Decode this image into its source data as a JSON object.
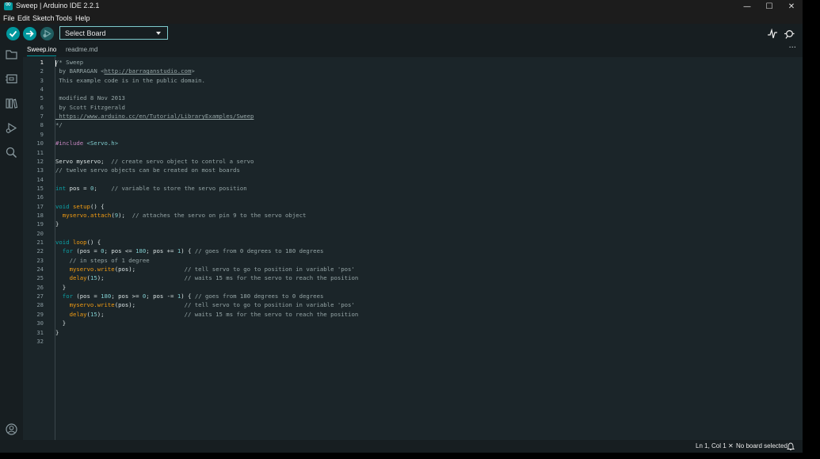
{
  "window": {
    "title": "Sweep | Arduino IDE 2.2.1",
    "controls": [
      "—",
      "☐",
      "✕"
    ]
  },
  "menu": {
    "items": [
      "File",
      "Edit",
      "Sketch",
      "Tools",
      "Help"
    ]
  },
  "toolbar": {
    "verify_icon": "check-icon",
    "upload_icon": "arrow-right-icon",
    "debug_icon": "debug-icon",
    "board_select": "Select Board",
    "serial_plotter_icon": "plotter-icon",
    "serial_monitor_icon": "monitor-icon"
  },
  "sidebar": {
    "icons": [
      "folder-icon",
      "board-icon",
      "library-icon",
      "debug-icon",
      "search-icon"
    ],
    "profile_icon": "user-icon"
  },
  "tabs": [
    {
      "label": "Sweep.ino",
      "active": true
    },
    {
      "label": "readme.md",
      "active": false
    }
  ],
  "tabs_more": "···",
  "editor": {
    "current_line": 1,
    "lines": [
      {
        "n": "1",
        "tokens": [
          [
            "c-com",
            "/* Sweep"
          ]
        ]
      },
      {
        "n": "2",
        "tokens": [
          [
            "c-com",
            " by BARRAGAN <"
          ],
          [
            "c-com c-link",
            "http://barraganstudio.com"
          ],
          [
            "c-com",
            ">"
          ]
        ]
      },
      {
        "n": "3",
        "tokens": [
          [
            "c-com",
            " This example code is in the public domain."
          ]
        ]
      },
      {
        "n": "4",
        "tokens": []
      },
      {
        "n": "5",
        "tokens": [
          [
            "c-com",
            " modified 8 Nov 2013"
          ]
        ]
      },
      {
        "n": "6",
        "tokens": [
          [
            "c-com",
            " by Scott Fitzgerald"
          ]
        ]
      },
      {
        "n": "7",
        "tokens": [
          [
            "c-com c-link",
            " https://www.arduino.cc/en/Tutorial/LibraryExamples/Sweep"
          ]
        ]
      },
      {
        "n": "8",
        "tokens": [
          [
            "c-com",
            "*/"
          ]
        ]
      },
      {
        "n": "9",
        "tokens": []
      },
      {
        "n": "10",
        "tokens": [
          [
            "c-pre",
            "#include "
          ],
          [
            "c-inc",
            "<Servo.h>"
          ]
        ]
      },
      {
        "n": "11",
        "tokens": []
      },
      {
        "n": "12",
        "tokens": [
          [
            "",
            "Servo myservo;  "
          ],
          [
            "c-com",
            "// create servo object to control a servo"
          ]
        ]
      },
      {
        "n": "13",
        "tokens": [
          [
            "c-com",
            "// twelve servo objects can be created on most boards"
          ]
        ]
      },
      {
        "n": "14",
        "tokens": []
      },
      {
        "n": "15",
        "tokens": [
          [
            "c-kw",
            "int"
          ],
          [
            "",
            " pos = "
          ],
          [
            "c-num",
            "0"
          ],
          [
            "",
            ";    "
          ],
          [
            "c-com",
            "// variable to store the servo position"
          ]
        ]
      },
      {
        "n": "16",
        "tokens": []
      },
      {
        "n": "17",
        "tokens": [
          [
            "c-kw",
            "void"
          ],
          [
            "",
            " "
          ],
          [
            "c-fn",
            "setup"
          ],
          [
            "",
            "() {"
          ]
        ]
      },
      {
        "n": "18",
        "tokens": [
          [
            "",
            "  "
          ],
          [
            "c-fn",
            "myservo.attach"
          ],
          [
            "",
            "("
          ],
          [
            "c-num",
            "9"
          ],
          [
            "",
            ");  "
          ],
          [
            "c-com",
            "// attaches the servo on pin 9 to the servo object"
          ]
        ]
      },
      {
        "n": "19",
        "tokens": [
          [
            "",
            "}"
          ]
        ]
      },
      {
        "n": "20",
        "tokens": []
      },
      {
        "n": "21",
        "tokens": [
          [
            "c-kw",
            "void"
          ],
          [
            "",
            " "
          ],
          [
            "c-fn",
            "loop"
          ],
          [
            "",
            "() {"
          ]
        ]
      },
      {
        "n": "22",
        "tokens": [
          [
            "",
            "  "
          ],
          [
            "c-kw",
            "for"
          ],
          [
            "",
            " (pos = "
          ],
          [
            "c-num",
            "0"
          ],
          [
            "",
            "; pos <= "
          ],
          [
            "c-num",
            "180"
          ],
          [
            "",
            "; pos += "
          ],
          [
            "c-num",
            "1"
          ],
          [
            "",
            ") { "
          ],
          [
            "c-com",
            "// goes from 0 degrees to 180 degrees"
          ]
        ]
      },
      {
        "n": "23",
        "tokens": [
          [
            "c-com",
            "    // in steps of 1 degree"
          ]
        ]
      },
      {
        "n": "24",
        "tokens": [
          [
            "",
            "    "
          ],
          [
            "c-fn",
            "myservo.write"
          ],
          [
            "",
            "(pos);              "
          ],
          [
            "c-com",
            "// tell servo to go to position in variable 'pos'"
          ]
        ]
      },
      {
        "n": "25",
        "tokens": [
          [
            "",
            "    "
          ],
          [
            "c-fn",
            "delay"
          ],
          [
            "",
            "("
          ],
          [
            "c-num",
            "15"
          ],
          [
            "",
            ");                       "
          ],
          [
            "c-com",
            "// waits 15 ms for the servo to reach the position"
          ]
        ]
      },
      {
        "n": "26",
        "tokens": [
          [
            "",
            "  }"
          ]
        ]
      },
      {
        "n": "27",
        "tokens": [
          [
            "",
            "  "
          ],
          [
            "c-kw",
            "for"
          ],
          [
            "",
            " (pos = "
          ],
          [
            "c-num",
            "180"
          ],
          [
            "",
            "; pos >= "
          ],
          [
            "c-num",
            "0"
          ],
          [
            "",
            "; pos -= "
          ],
          [
            "c-num",
            "1"
          ],
          [
            "",
            ") { "
          ],
          [
            "c-com",
            "// goes from 180 degrees to 0 degrees"
          ]
        ]
      },
      {
        "n": "28",
        "tokens": [
          [
            "",
            "    "
          ],
          [
            "c-fn",
            "myservo.write"
          ],
          [
            "",
            "(pos);              "
          ],
          [
            "c-com",
            "// tell servo to go to position in variable 'pos'"
          ]
        ]
      },
      {
        "n": "29",
        "tokens": [
          [
            "",
            "    "
          ],
          [
            "c-fn",
            "delay"
          ],
          [
            "",
            "("
          ],
          [
            "c-num",
            "15"
          ],
          [
            "",
            ");                       "
          ],
          [
            "c-com",
            "// waits 15 ms for the servo to reach the position"
          ]
        ]
      },
      {
        "n": "30",
        "tokens": [
          [
            "",
            "  }"
          ]
        ]
      },
      {
        "n": "31",
        "tokens": [
          [
            "",
            "}"
          ]
        ]
      },
      {
        "n": "32",
        "tokens": []
      }
    ]
  },
  "status": {
    "position": "Ln 1, Col 1",
    "board": "No board selected",
    "board_icon": "close-icon",
    "notifications_icon": "bell-icon"
  },
  "colors": {
    "accent": "#00979d",
    "background": "#171e21",
    "editor": "#1b2529"
  }
}
